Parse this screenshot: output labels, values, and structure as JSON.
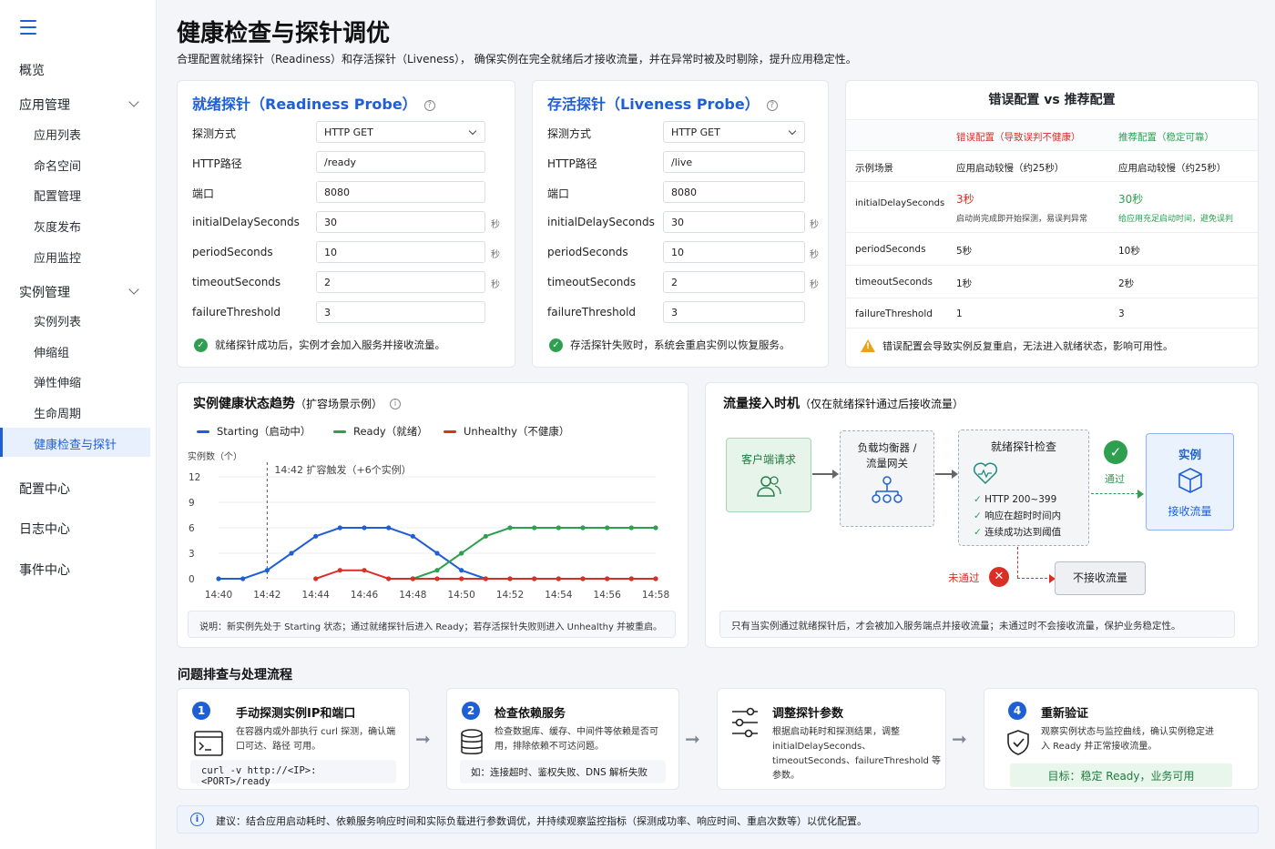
{
  "sidebar": {
    "overview": "概览",
    "app_mgmt": "应用管理",
    "app_items": [
      "应用列表",
      "命名空间",
      "配置管理",
      "灰度发布",
      "应用监控"
    ],
    "instance_mgmt": "实例管理",
    "instance_items": [
      "实例列表",
      "伸缩组",
      "弹性伸缩",
      "生命周期",
      "健康检查与探针"
    ],
    "config_center": "配置中心",
    "log_center": "日志中心",
    "event_center": "事件中心"
  },
  "header": {
    "title": "健康检查与探针调优",
    "subtitle": "合理配置就绪探针（Readiness）和存活探针（Liveness），  确保实例在完全就绪后才接收流量，并在异常时被及时剔除，提升应用稳定性。"
  },
  "readiness": {
    "title": "就绪探针（Readiness Probe）",
    "labels": [
      "探测方式",
      "HTTP路径",
      "端口",
      "initialDelaySeconds",
      "periodSeconds",
      "timeoutSeconds",
      "failureThreshold"
    ],
    "values": [
      "HTTP GET",
      "/ready",
      "8080",
      "30",
      "10",
      "2",
      "3"
    ],
    "unit": "秒",
    "note": "就绪探针成功后，实例才会加入服务并接收流量。"
  },
  "liveness": {
    "title": "存活探针（Liveness Probe）",
    "labels": [
      "探测方式",
      "HTTP路径",
      "端口",
      "initialDelaySeconds",
      "periodSeconds",
      "timeoutSeconds",
      "failureThreshold"
    ],
    "values": [
      "HTTP GET",
      "/live",
      "8080",
      "30",
      "10",
      "2",
      "3"
    ],
    "unit": "秒",
    "note": "存活探针失败时，系统会重启实例以恢复服务。"
  },
  "compare": {
    "title": "错误配置 vs 推荐配置",
    "col_bad": "错误配置（导致误判不健康）",
    "col_good": "推荐配置（稳定可靠）",
    "rows": [
      {
        "label": "示例场景",
        "bad": "应用启动较慢（约25秒）",
        "good": "应用启动较慢（约25秒）"
      },
      {
        "label": "initialDelaySeconds",
        "bad": "3秒",
        "bad_note": "启动尚完成即开始探测，易误判异常",
        "good": "30秒",
        "good_note": "给应用充足启动时间，避免误判"
      },
      {
        "label": "periodSeconds",
        "bad": "5秒",
        "good": "10秒"
      },
      {
        "label": "timeoutSeconds",
        "bad": "1秒",
        "good": "2秒"
      },
      {
        "label": "failureThreshold",
        "bad": "1",
        "good": "3"
      }
    ],
    "warning": "错误配置会导致实例反复重启，无法进入就绪状态，影响可用性。",
    "colors": {
      "bad": "#d93026",
      "good": "#2e9f4f"
    }
  },
  "trend": {
    "title": "实例健康状态趋势",
    "title_sub": "（扩容场景示例）",
    "legend": [
      "Starting（启动中）",
      "Ready（就绪）",
      "Unhealthy（不健康）"
    ],
    "annotation": "14:42  扩容触发（+6个实例）",
    "note": "说明：新实例先处于 Starting 状态；通过就绪探针后进入 Ready；若存活探针失败则进入 Unhealthy 并被重启。"
  },
  "chart_data": {
    "type": "line",
    "ylabel": "实例数（个）",
    "ylim": [
      0,
      12
    ],
    "yticks": [
      0,
      3,
      6,
      9,
      12
    ],
    "x": [
      "14:40",
      "14:41",
      "14:42",
      "14:43",
      "14:44",
      "14:45",
      "14:46",
      "14:47",
      "14:48",
      "14:49",
      "14:50",
      "14:51",
      "14:52",
      "14:53",
      "14:54",
      "14:55",
      "14:56",
      "14:57",
      "14:58"
    ],
    "xticks": [
      "14:40",
      "14:42",
      "14:44",
      "14:46",
      "14:48",
      "14:50",
      "14:52",
      "14:54",
      "14:56",
      "14:58"
    ],
    "series": [
      {
        "name": "Starting（启动中）",
        "color": "#1f5fd6",
        "values": [
          0,
          0,
          1,
          3,
          5,
          6,
          6,
          6,
          5,
          3,
          1,
          0,
          0,
          0,
          0,
          0,
          0,
          0,
          0
        ]
      },
      {
        "name": "Ready（就绪）",
        "color": "#2e9f4f",
        "values": [
          null,
          null,
          null,
          null,
          null,
          null,
          null,
          null,
          0,
          1,
          3,
          5,
          6,
          6,
          6,
          6,
          6,
          6,
          6
        ]
      },
      {
        "name": "Unhealthy（不健康）",
        "color": "#d93026",
        "values": [
          null,
          null,
          null,
          null,
          0,
          1,
          1,
          0,
          0,
          0,
          0,
          0,
          0,
          0,
          0,
          0,
          0,
          0,
          0
        ]
      }
    ]
  },
  "flow": {
    "title": "流量接入时机",
    "title_sub": "（仅在就绪探针通过后接收流量）",
    "client": "客户端请求",
    "lb": "负载均衡器 /\n流量网关",
    "check_title": "就绪探针检查",
    "checks": [
      "HTTP 200~399",
      "响应在超时时间内",
      "连续成功达到阈值"
    ],
    "pass": "通过",
    "instance": "实例",
    "receive": "接收流量",
    "fail": "未通过",
    "no_traffic": "不接收流量",
    "note": "只有当实例通过就绪探针后，才会被加入服务端点并接收流量；未通过时不会接收流量，保护业务稳定性。"
  },
  "troubleshoot": {
    "title": "问题排查与处理流程",
    "steps": [
      {
        "num": "1",
        "title": "手动探测实例IP和端口",
        "desc": "在容器内或外部执行 curl 探测，确认端口可达、路径 可用。",
        "foot": "curl -v http://<IP>:<PORT>/ready"
      },
      {
        "num": "2",
        "title": "检查依赖服务",
        "desc": "检查数据库、缓存、中间件等依赖是否可用，排除依赖不可达问题。",
        "foot": "如：连接超时、鉴权失败、DNS 解析失败"
      },
      {
        "num": "",
        "title": "调整探针参数",
        "desc": "根据启动耗时和探测结果，调整 initialDelaySeconds、timeoutSeconds、failureThreshold 等参数。",
        "foot": ""
      },
      {
        "num": "4",
        "title": "重新验证",
        "desc": "观察实例状态与监控曲线，确认实例稳定进入 Ready 并正常接收流量。",
        "foot": "目标：稳定 Ready，业务可用"
      }
    ],
    "tip": "建议：结合应用启动耗时、依赖服务响应时间和实际负载进行参数调优，并持续观察监控指标（探测成功率、响应时间、重启次数等）以优化配置。"
  }
}
